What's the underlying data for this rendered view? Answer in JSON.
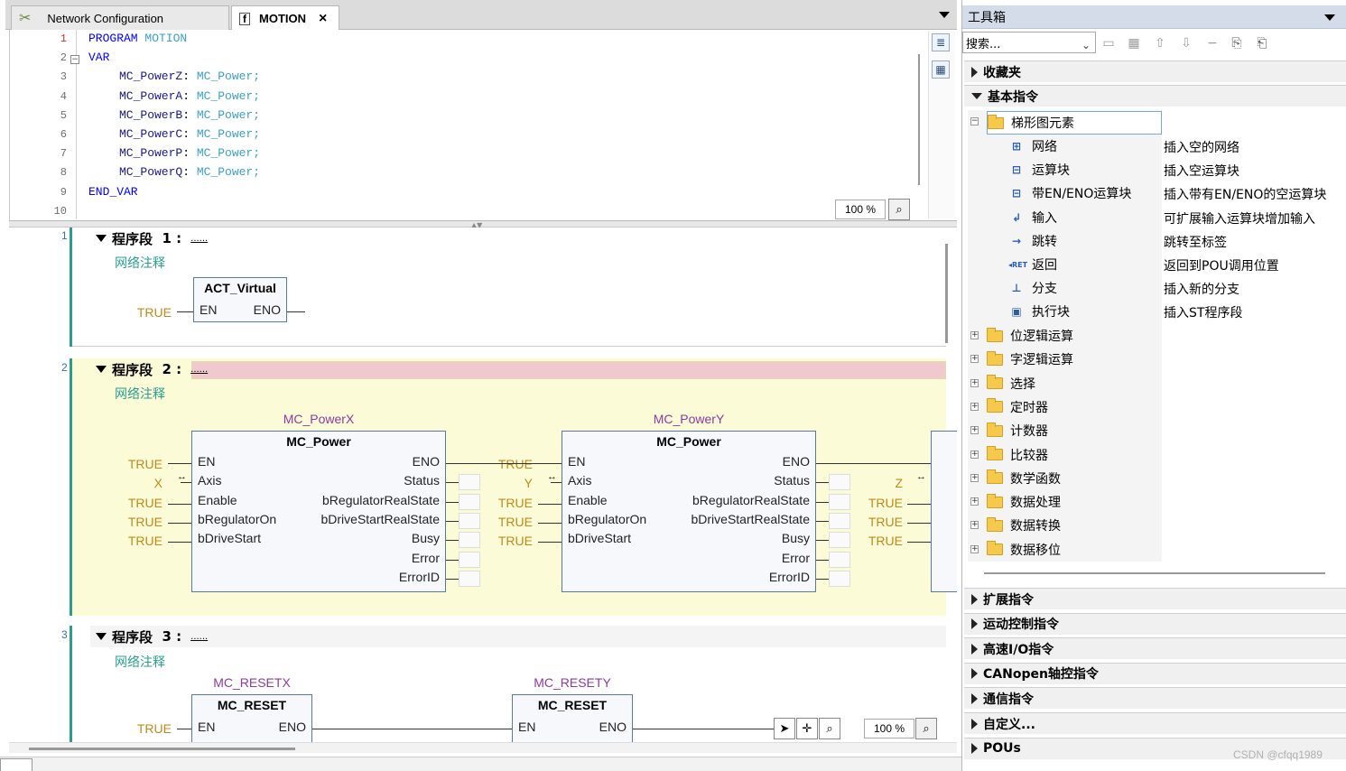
{
  "tabs": [
    {
      "label": "Network Configuration",
      "icon": "network-config-icon"
    },
    {
      "label": "MOTION",
      "icon": "pou-file-icon",
      "close": "×"
    }
  ],
  "editor": {
    "code_lines": [
      {
        "n": "1",
        "kw": "PROGRAM",
        "id": "MOTION"
      },
      {
        "n": "2",
        "kw": "VAR"
      },
      {
        "n": "3",
        "var": "MC_PowerZ",
        "type": "MC_Power;"
      },
      {
        "n": "4",
        "var": "MC_PowerA",
        "type": "MC_Power;"
      },
      {
        "n": "5",
        "var": "MC_PowerB",
        "type": "MC_Power;"
      },
      {
        "n": "6",
        "var": "MC_PowerC",
        "type": "MC_Power;"
      },
      {
        "n": "7",
        "var": "MC_PowerP",
        "type": "MC_Power;"
      },
      {
        "n": "8",
        "var": "MC_PowerQ",
        "type": "MC_Power;"
      },
      {
        "n": "9",
        "kw": "END_VAR"
      },
      {
        "n": "10"
      }
    ],
    "zoom": "100 %"
  },
  "ladder": {
    "zoom": "100 %",
    "comment": "网络注释",
    "true_literal": "TRUE",
    "networks": [
      {
        "num": "1",
        "title": "程序段",
        "index": "1 :",
        "dots": "......"
      },
      {
        "num": "2",
        "title": "程序段",
        "index": "2 :",
        "dots": "......"
      },
      {
        "num": "3",
        "title": "程序段",
        "index": "3 :",
        "dots": "......"
      }
    ],
    "act_virtual": {
      "name": "ACT_Virtual",
      "in": "EN",
      "out": "ENO"
    },
    "power_blocks": [
      {
        "instance": "MC_PowerX",
        "type": "MC_Power",
        "axis_var": "X"
      },
      {
        "instance": "MC_PowerY",
        "type": "MC_Power",
        "axis_var": "Y"
      }
    ],
    "next_axis_var": "Z",
    "power_inputs": [
      "EN",
      "Axis",
      "Enable",
      "bRegulatorOn",
      "bDriveStart"
    ],
    "power_outputs": [
      "ENO",
      "Status",
      "bRegulatorRealState",
      "bDriveStartRealState",
      "Busy",
      "Error",
      "ErrorID"
    ],
    "reset_blocks": [
      {
        "instance": "MC_RESETX",
        "type": "MC_RESET",
        "in": "EN",
        "out": "ENO"
      },
      {
        "instance": "MC_RESETY",
        "type": "MC_RESET",
        "in": "EN",
        "out": "ENO"
      }
    ]
  },
  "toolbox": {
    "title": "工具箱",
    "search_placeholder": "搜索...",
    "categories_top": [
      {
        "label": "收藏夹",
        "open": false
      },
      {
        "label": "基本指令",
        "open": true
      }
    ],
    "ladder_group": "梯形图元素",
    "ladder_items": [
      {
        "label": "网络",
        "desc": "插入空的网络",
        "icon": "network-icon",
        "glyph": "⊞"
      },
      {
        "label": "运算块",
        "desc": "插入空运算块",
        "icon": "box-icon",
        "glyph": "⊟"
      },
      {
        "label": "带EN/ENO运算块",
        "desc": "插入带有EN/ENO的空运算块",
        "icon": "box-en-icon",
        "glyph": "⊟"
      },
      {
        "label": "输入",
        "desc": "可扩展输入运算块增加输入",
        "icon": "input-icon",
        "glyph": "↲"
      },
      {
        "label": "跳转",
        "desc": "跳转至标签",
        "icon": "jump-icon",
        "glyph": "→"
      },
      {
        "label": "返回",
        "desc": "返回到POU调用位置",
        "icon": "return-icon",
        "glyph": "◂RET"
      },
      {
        "label": "分支",
        "desc": "插入新的分支",
        "icon": "branch-icon",
        "glyph": "⊥"
      },
      {
        "label": "执行块",
        "desc": "插入ST程序段",
        "icon": "exec-block-icon",
        "glyph": "▣"
      }
    ],
    "folders": [
      "位逻辑运算",
      "字逻辑运算",
      "选择",
      "定时器",
      "计数器",
      "比较器",
      "数学函数",
      "数据处理",
      "数据转换",
      "数据移位"
    ],
    "categories_bottom": [
      "扩展指令",
      "运动控制指令",
      "高速I/O指令",
      "CANopen轴控指令",
      "通信指令",
      "自定义...",
      "POUs"
    ]
  },
  "watermark": "CSDN @cfqq1989"
}
